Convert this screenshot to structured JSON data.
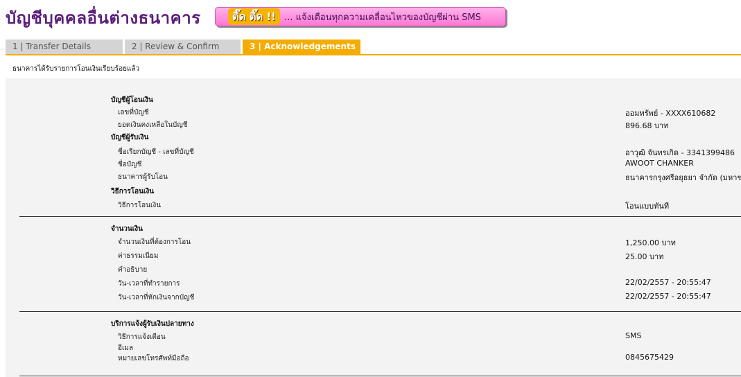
{
  "header": {
    "title": "บัญชีบุคคลอื่นต่างธนาคาร",
    "banner_badge": "ติ๊ด ติ๊ด !!",
    "banner_text": "... แจ้งเตือนทุกความเคลื่อนไหวของบัญชีผ่าน SMS",
    "banner_color": "#ff8fdc"
  },
  "tabs": [
    {
      "label": "1 | Transfer Details"
    },
    {
      "label": "2 | Review & Confirm"
    },
    {
      "label": "3 | Acknowledgements",
      "active": true
    }
  ],
  "accent_color": "#f5ac00",
  "notice": "ธนาคารได้รับรายการโอนเงินเรียบร้อยแล้ว",
  "from_account": {
    "heading": "บัญชีผู้โอนเงิน",
    "account_no_label": "เลขที่บัญชี",
    "account_no_value": "ออมทรัพย์ - XXXX610682",
    "balance_label": "ยอดเงินคงเหลือในบัญชี",
    "balance_value": "896.68 บาท"
  },
  "to_account": {
    "heading": "บัญชีผู้รับเงิน",
    "nickname_label": "ชื่อเรียกบัญชี - เลขที่บัญชี",
    "nickname_value": "อาวุฒิ จันทรเกิด - 3341399486",
    "name_label": "ชื่อบัญชี",
    "name_value": "AWOOT CHANKER",
    "bank_label": "ธนาคารผู้รับโอน",
    "bank_value": "ธนาคารกรุงศรีอยุธยา จำกัด (มหาชน)"
  },
  "method": {
    "heading": "วิธีการโอนเงิน",
    "label": "วิธีการโอนเงิน",
    "value": "โอนแบบทันที"
  },
  "amount": {
    "heading": "จำนวนเงิน",
    "amount_label": "จำนวนเงินที่ต้องการโอน",
    "amount_value": "1,250.00 บาท",
    "fee_label": "ค่าธรรมเนียม",
    "fee_value": "25.00  บาท",
    "desc_label": "คำอธิบาย",
    "desc_value": "",
    "txn_time_label": "วัน-เวลาที่ทำรายการ",
    "txn_time_value": "22/02/2557 - 20:55:47",
    "debit_time_label": "วัน-เวลาที่หักเงินจากบัญชี",
    "debit_time_value": "22/02/2557 - 20:55:47"
  },
  "notify": {
    "heading": "บริการแจ้งผู้รับเงินปลายทาง",
    "method_label": "วิธีการแจ้งเตือน",
    "method_value": "SMS",
    "email_label": "อีเมล",
    "email_value": "",
    "phone_label": "หมายเลขโทรศัพท์มือถือ",
    "phone_value": "0845675429"
  }
}
